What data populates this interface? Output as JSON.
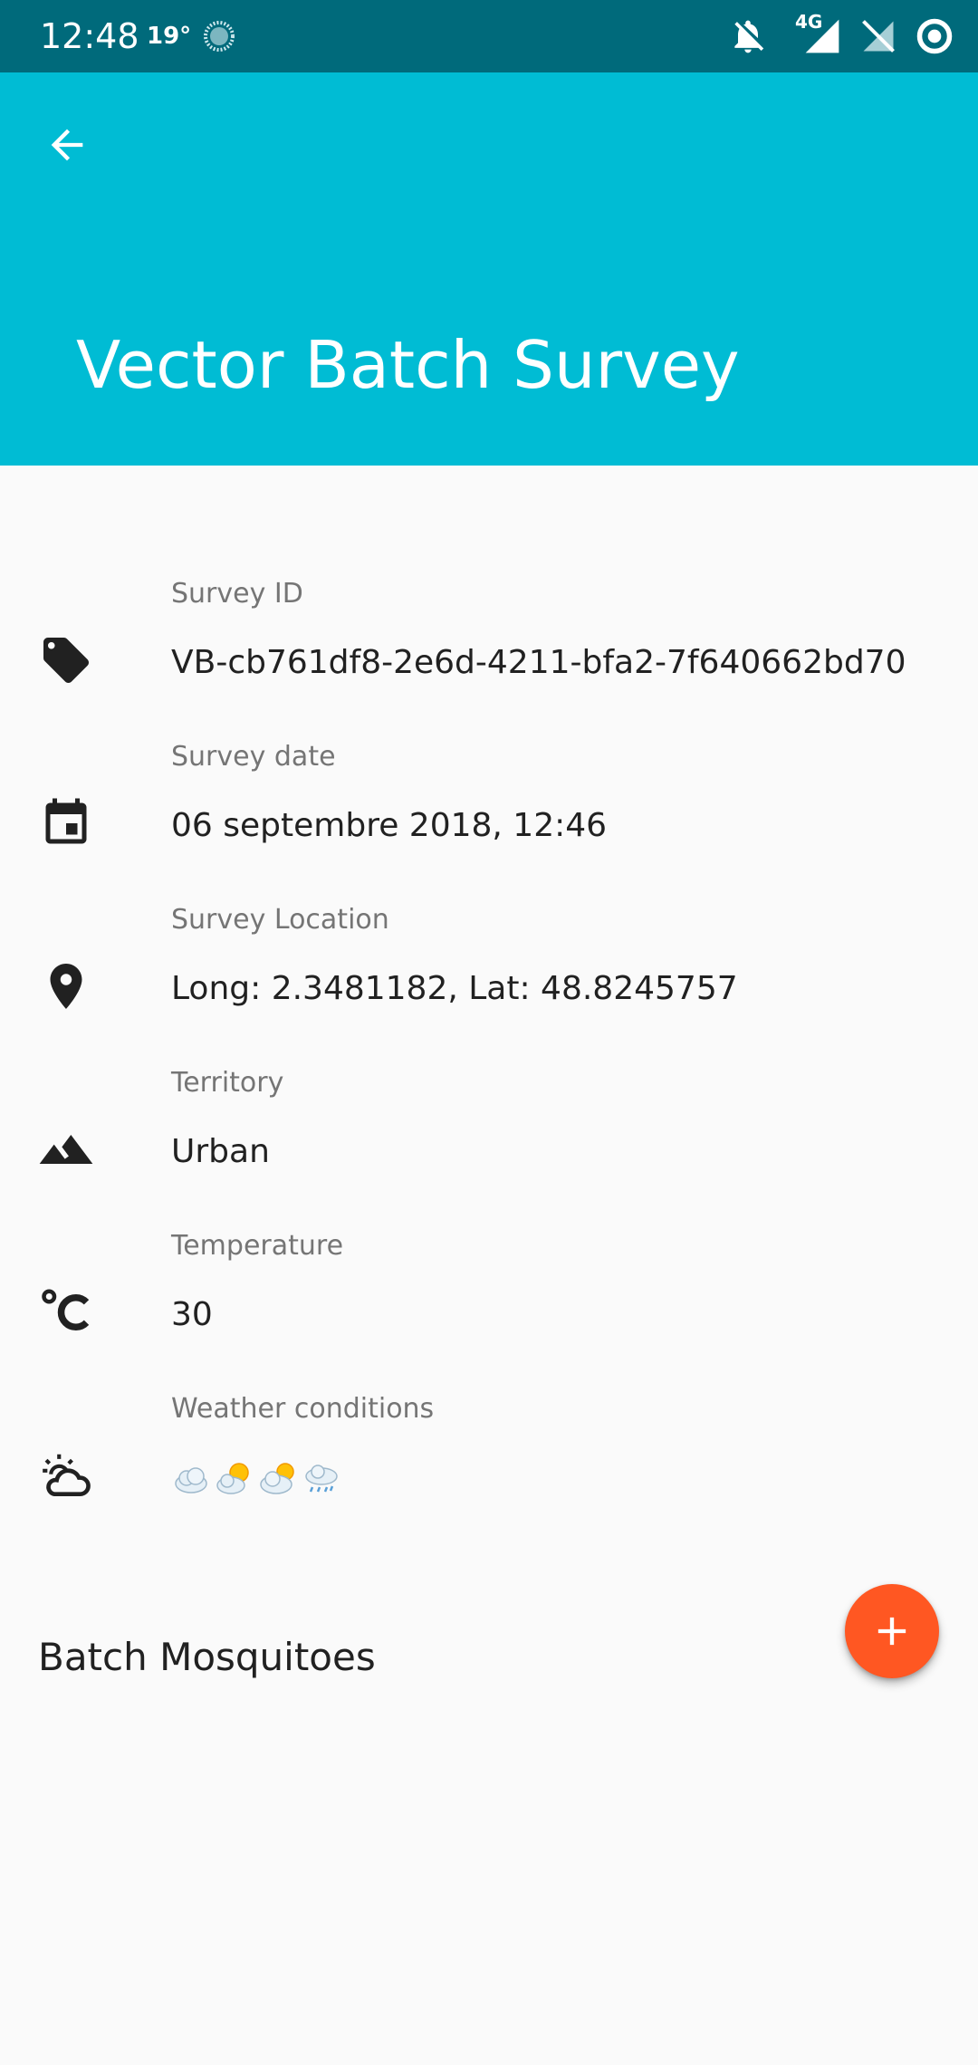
{
  "status_bar": {
    "time": "12:48",
    "temperature": "19°",
    "network": "4G",
    "icons": [
      "weather-icon",
      "notifications-off-icon",
      "signal-icon",
      "no-sim-icon",
      "sync-icon"
    ]
  },
  "app_bar": {
    "title": "Vector Batch Survey",
    "back_icon": "arrow-left-icon",
    "color": "#00bcd4"
  },
  "details": [
    {
      "icon": "tag-icon",
      "label": "Survey ID",
      "value": "VB-cb761df8-2e6d-4211-bfa2-7f640662bd70"
    },
    {
      "icon": "calendar-icon",
      "label": "Survey date",
      "value": "06 septembre 2018, 12:46"
    },
    {
      "icon": "location-pin-icon",
      "label": "Survey Location",
      "value": "Long: 2.3481182, Lat: 48.8245757"
    },
    {
      "icon": "terrain-icon",
      "label": "Territory",
      "value": "Urban"
    },
    {
      "icon": "celsius-icon",
      "label": "Temperature",
      "value": "30"
    },
    {
      "icon": "weather-partly-cloudy-icon",
      "label": "Weather conditions",
      "value_icons": [
        "cloud-icon",
        "sun-behind-cloud-icon",
        "sun-behind-cloud-icon",
        "rain-cloud-icon"
      ]
    }
  ],
  "section": {
    "title": "Batch Mosquitoes"
  },
  "fab": {
    "icon": "plus-icon",
    "color": "#ff5722"
  }
}
